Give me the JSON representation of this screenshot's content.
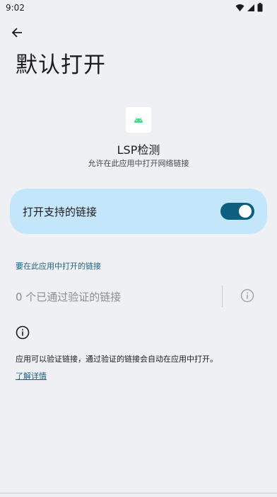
{
  "status_bar": {
    "time": "9:02"
  },
  "header": {
    "title": "默认打开"
  },
  "app": {
    "name": "LSP检测",
    "subtitle": "允许在此应用中打开网络链接",
    "icon": "android-icon"
  },
  "toggle": {
    "label": "打开支持的链接",
    "state": "on"
  },
  "section": {
    "header": "要在此应用中打开的链接",
    "verified_links": "0 个已通过验证的链接"
  },
  "footer": {
    "text": "应用可以验证链接，通过验证的链接会自动在应用中打开。",
    "learn_more": "了解详情"
  },
  "colors": {
    "background": "#eff0f4",
    "accent": "#0d5f80",
    "card": "#c4e6fa",
    "link": "#1c5f80"
  }
}
